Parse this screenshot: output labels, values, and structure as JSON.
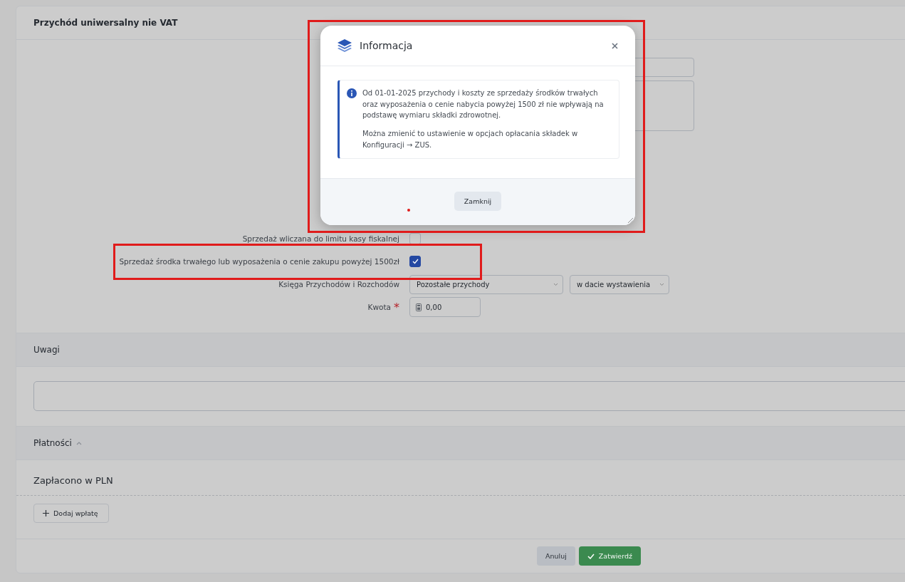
{
  "form": {
    "title": "Przychód uniwersalny nie VAT",
    "rows": [
      {
        "kind": "checkbox",
        "label": "Sprzedaż wliczana do limitu kasy fiskalnej",
        "checked": false
      },
      {
        "kind": "checkbox",
        "label": "Sprzedaż środka trwałego lub wyposażenia o cenie zakupu powyżej 1500zł",
        "checked": true
      },
      {
        "kind": "selects",
        "label": "Księga Przychodów i Rozchodów",
        "values": [
          "Pozostałe przychody",
          "w dacie wystawienia"
        ]
      },
      {
        "kind": "amount",
        "label": "Kwota",
        "required_mark": "*",
        "value": "0,00"
      }
    ]
  },
  "notes": {
    "title": "Uwagi"
  },
  "payments": {
    "title": "Płatności",
    "expanded": true,
    "subtitle": "Zapłacono w PLN",
    "add_button": "Dodaj wpłatę"
  },
  "footer": {
    "buttons": [
      {
        "label": "Anuluj",
        "kind": "secondary"
      },
      {
        "label": "Zatwierdź",
        "kind": "primary"
      }
    ]
  },
  "modal": {
    "title": "Informacja",
    "paragraphs": [
      "Od 01-01-2025 przychody i koszty ze sprzedaży środków trwałych oraz wyposażenia o cenie nabycia powyżej 1500 zł nie wpływają na podstawę wymiaru składki zdrowotnej.",
      "Można zmienić to ustawienie w opcjach opłacania składek w Konfiguracji → ZUS."
    ],
    "close_button": "Zamknij"
  }
}
